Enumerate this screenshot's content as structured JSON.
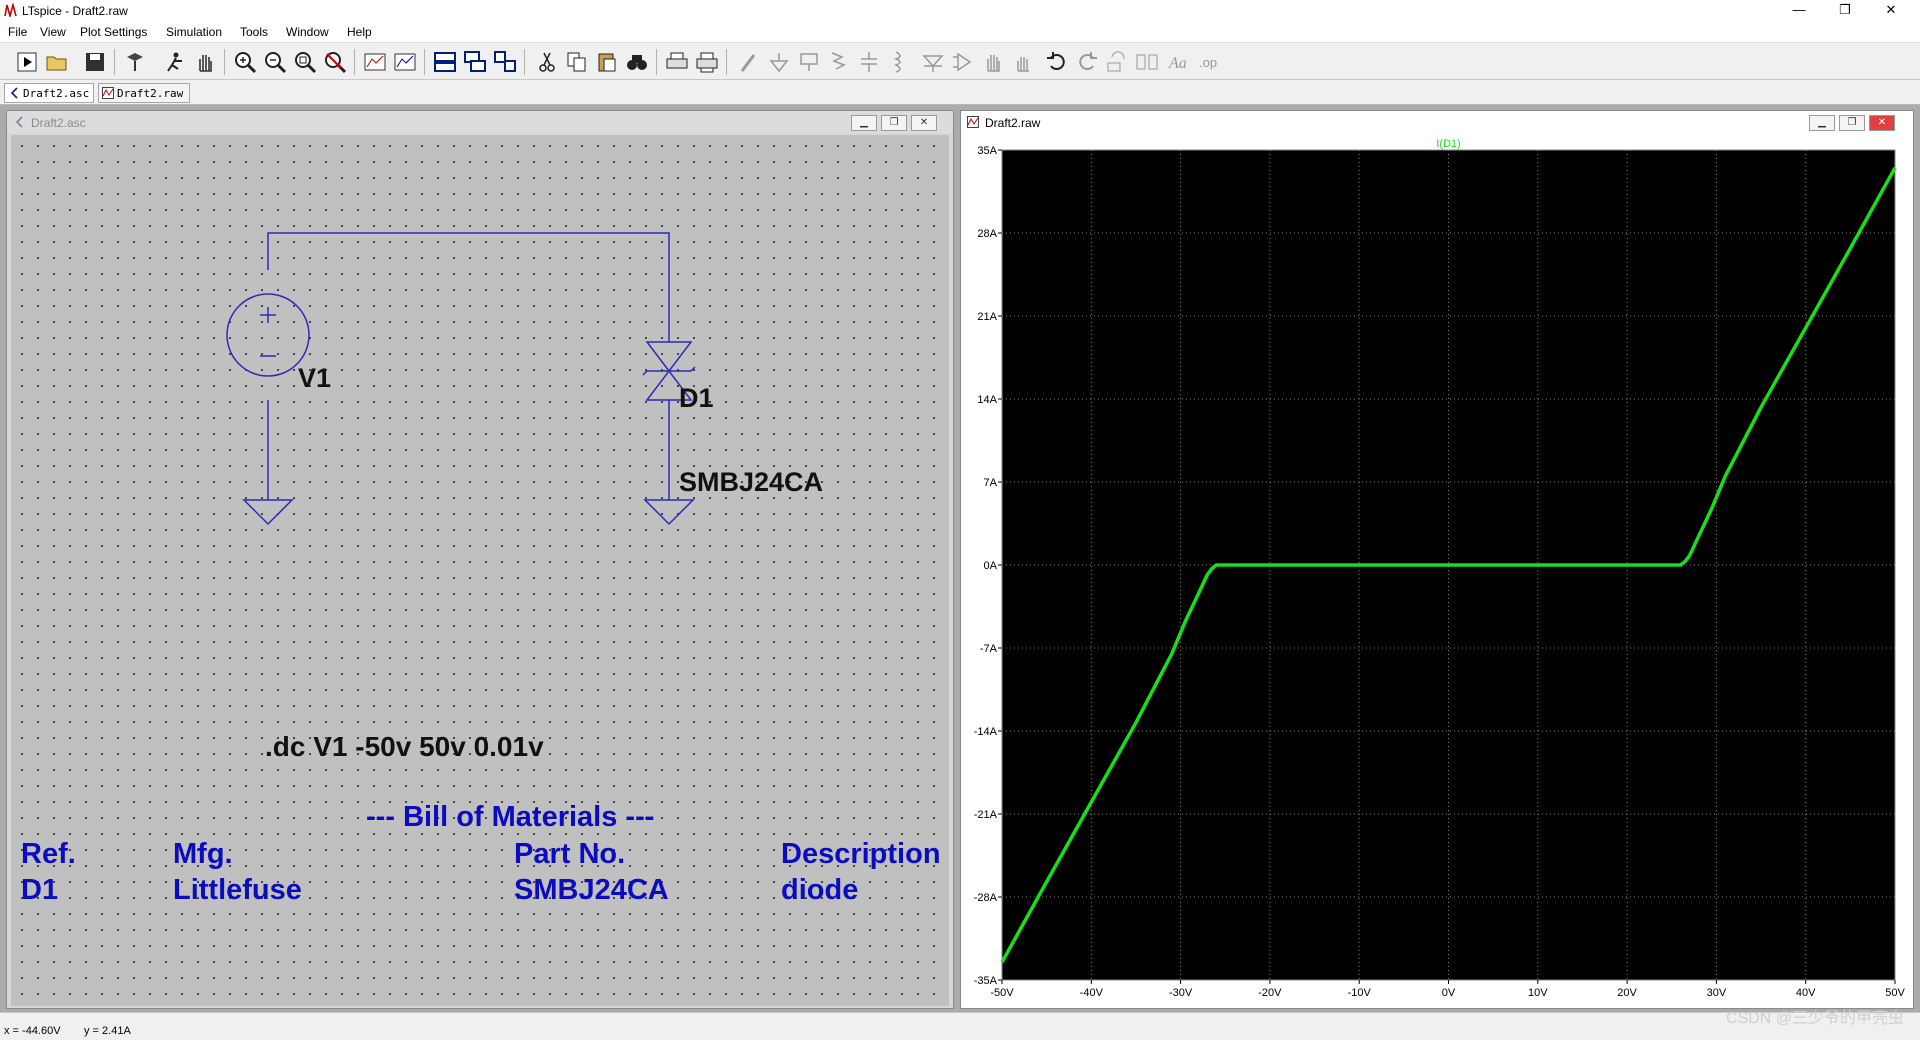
{
  "window": {
    "title": "LTspice - Draft2.raw",
    "minimize": "—",
    "maximize": "❐",
    "close": "✕"
  },
  "menu": [
    "File",
    "View",
    "Plot Settings",
    "Simulation",
    "Tools",
    "Window",
    "Help"
  ],
  "toolbar_icons": [
    "run-icon",
    "open-icon",
    "save-icon",
    "control-panel-icon",
    "halt-icon",
    "pan-icon",
    "zoom-in-icon",
    "zoom-out-icon",
    "zoom-full-icon",
    "zoom-cancel-icon",
    "autorange-icon",
    "manual-limits-icon",
    "tile-horizontal-icon",
    "cascade-icon",
    "tile-vertical-icon",
    "cut-icon",
    "copy-icon",
    "paste-icon",
    "find-icon",
    "print-icon",
    "print-setup-icon",
    "draw-wire-icon",
    "ground-icon",
    "label-net-icon",
    "resistor-icon",
    "capacitor-icon",
    "inductor-icon",
    "diode-icon",
    "component-icon",
    "move-icon",
    "drag-icon",
    "undo-icon",
    "redo-icon",
    "rotate-icon",
    "mirror-icon",
    "text-icon",
    "spice-directive-icon"
  ],
  "doc_tabs": [
    {
      "label": "Draft2.asc",
      "icon": "schematic-icon"
    },
    {
      "label": "Draft2.raw",
      "icon": "waveform-icon"
    }
  ],
  "schematic": {
    "title": "Draft2.asc",
    "v1_label": "V1",
    "v1_plus": "+",
    "v1_minus": "−",
    "d1_label": "D1",
    "d1_value": "SMBJ24CA",
    "directive": ".dc V1 -50v 50v 0.01v",
    "bom_title": "--- Bill of Materials ---",
    "bom_headers": [
      "Ref.",
      "Mfg.",
      "Part No.",
      "Description"
    ],
    "bom_row": [
      "D1",
      "Littlefuse",
      "SMBJ24CA",
      "diode"
    ],
    "wire_color": "#2b2bb8",
    "text_color": "#0b0bbf"
  },
  "plot": {
    "title": "Draft2.raw",
    "trace_color": "#18e018"
  },
  "chart_data": {
    "type": "line",
    "title": "I(D1)",
    "xlim": [
      -50,
      50
    ],
    "ylim": [
      -35,
      35
    ],
    "x_ticks": [
      "-50V",
      "-40V",
      "-30V",
      "-20V",
      "-10V",
      "0V",
      "10V",
      "20V",
      "30V",
      "40V",
      "50V"
    ],
    "y_ticks": [
      "35A",
      "28A",
      "21A",
      "14A",
      "7A",
      "0A",
      "-7A",
      "-14A",
      "-21A",
      "-28A",
      "-35A"
    ],
    "grid": true,
    "series": [
      {
        "name": "I(D1)",
        "x": [
          -50,
          -45,
          -40,
          -35,
          -31,
          -29.5,
          -28,
          -27,
          -26.5,
          -26,
          -20,
          -10,
          0,
          10,
          20,
          26,
          26.5,
          27,
          28,
          29.5,
          31,
          35,
          40,
          45,
          50
        ],
        "y": [
          -33.5,
          -26.7,
          -20.0,
          -13.3,
          -7.5,
          -4.8,
          -2.4,
          -0.8,
          -0.3,
          0,
          0,
          0,
          0,
          0,
          0,
          0,
          0.3,
          0.8,
          2.4,
          4.8,
          7.5,
          13.3,
          20.0,
          26.7,
          33.5
        ]
      }
    ]
  },
  "status": {
    "x": "x = -44.60V",
    "y": "y = 2.41A"
  },
  "watermark": "CSDN @三少爷的甲壳虫"
}
